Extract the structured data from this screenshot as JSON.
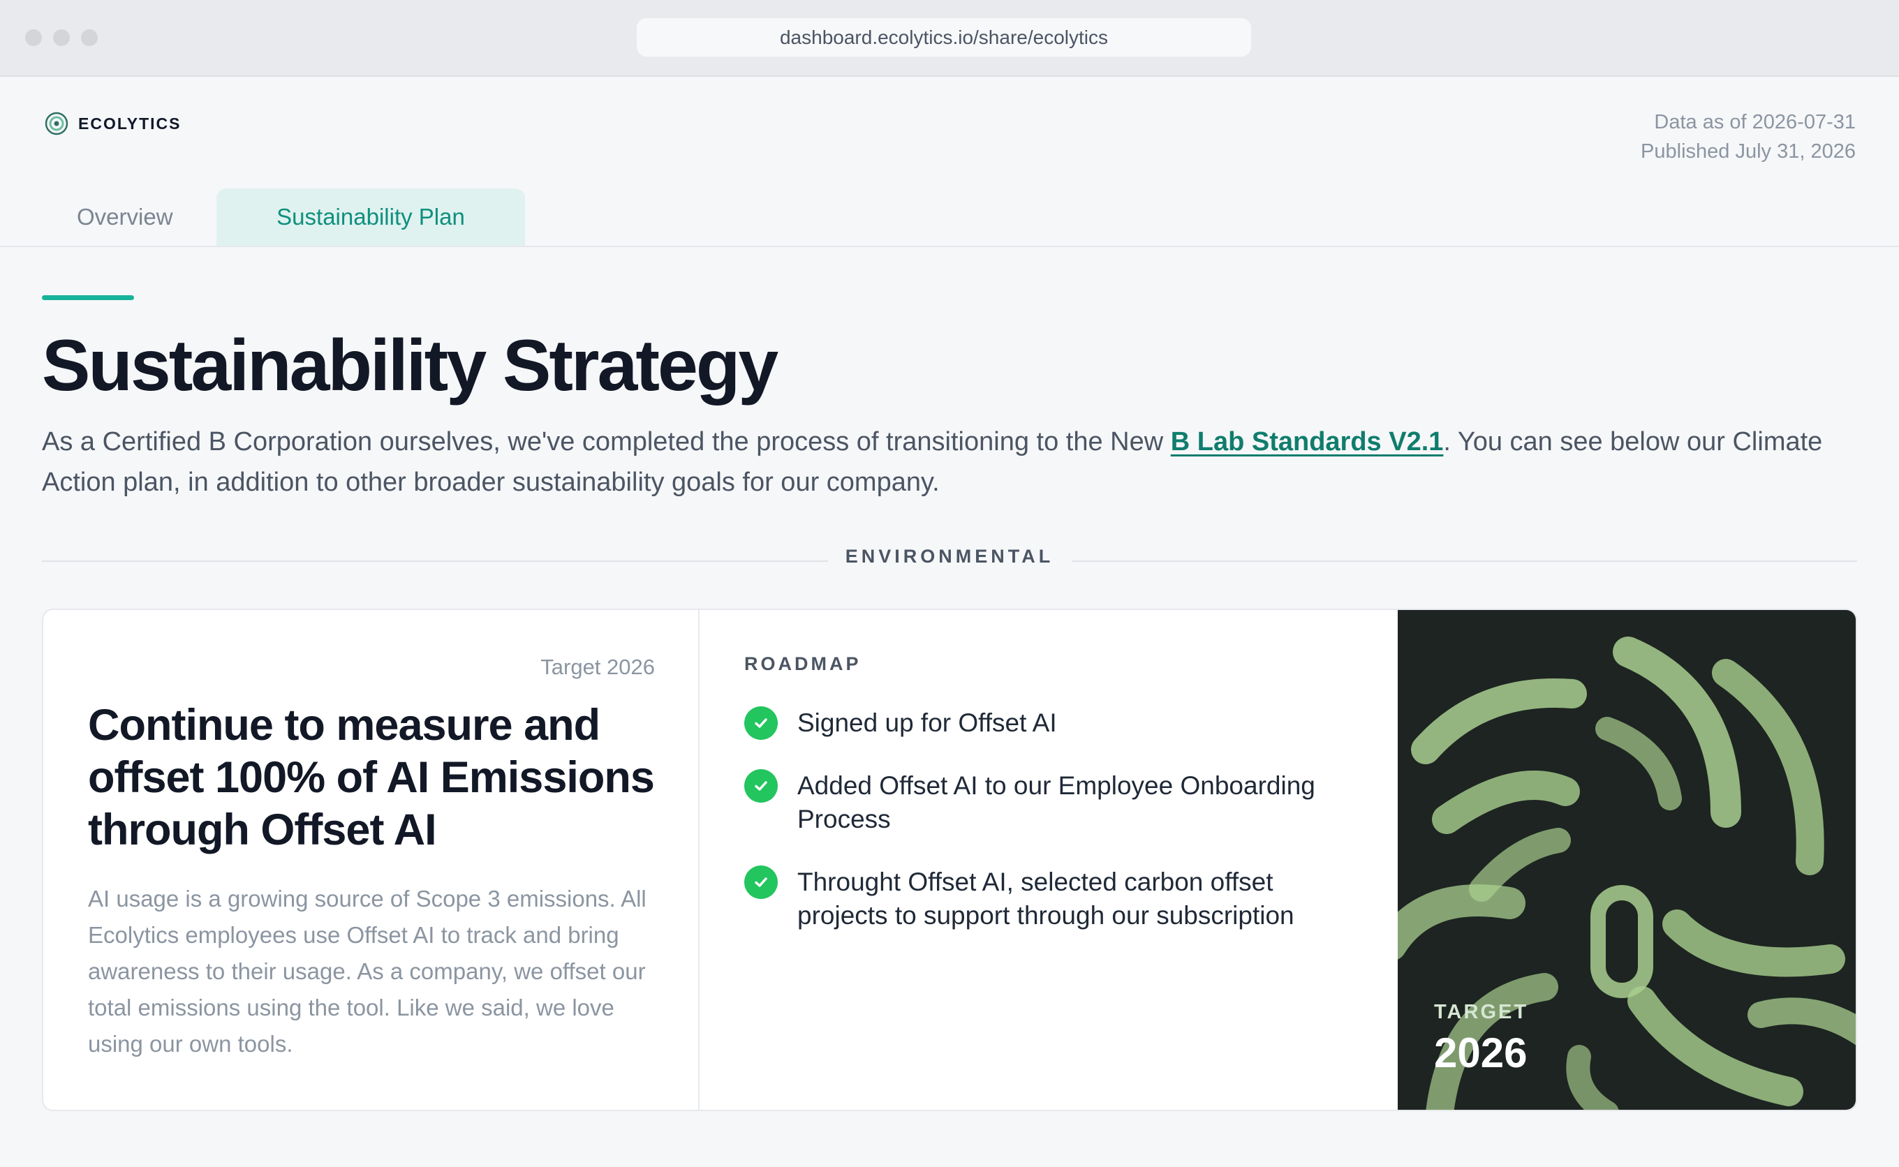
{
  "browser": {
    "url": "dashboard.ecolytics.io/share/ecolytics"
  },
  "brand": {
    "name": "ECOLYTICS",
    "accent": "#17b39a",
    "link_color": "#0f7d6d",
    "check_color": "#22c55e",
    "art_bg": "#1d2421",
    "art_fg": "#a9cf8f"
  },
  "meta": {
    "data_as_of": "Data as of 2026-07-31",
    "published": "Published July 31, 2026"
  },
  "tabs": [
    {
      "label": "Overview",
      "active": false
    },
    {
      "label": "Sustainability Plan",
      "active": true
    }
  ],
  "main": {
    "title": "Sustainability Strategy",
    "lede_before": "As a Certified B Corporation ourselves, we've completed the process of transitioning to the New ",
    "lede_link": "B Lab Standards V2.1",
    "lede_after": ". You can see below our Climate Action plan, in addition to other broader sustainability goals for our company."
  },
  "section": {
    "label": "ENVIRONMENTAL"
  },
  "goal": {
    "target_label": "Target 2026",
    "title": "Continue to measure and offset 100% of AI Emissions through Offset AI",
    "description": "AI usage is a growing source of Scope 3 emissions. All Ecolytics employees use Offset AI to track and bring awareness to their usage. As a company, we offset our total emissions using the tool. Like we said, we love using our own tools.",
    "roadmap_label": "ROADMAP",
    "roadmap": [
      {
        "text": "Signed up for Offset AI",
        "done": true
      },
      {
        "text": "Added Offset AI to our Employee Onboarding Process",
        "done": true
      },
      {
        "text": "Throught Offset AI, selected carbon offset projects to support through our subscription",
        "done": true
      }
    ],
    "art_target_label": "TARGET",
    "art_target_year": "2026"
  },
  "icons": {
    "logo": "ecolytics-logo-icon",
    "check": "check-circle-icon"
  }
}
